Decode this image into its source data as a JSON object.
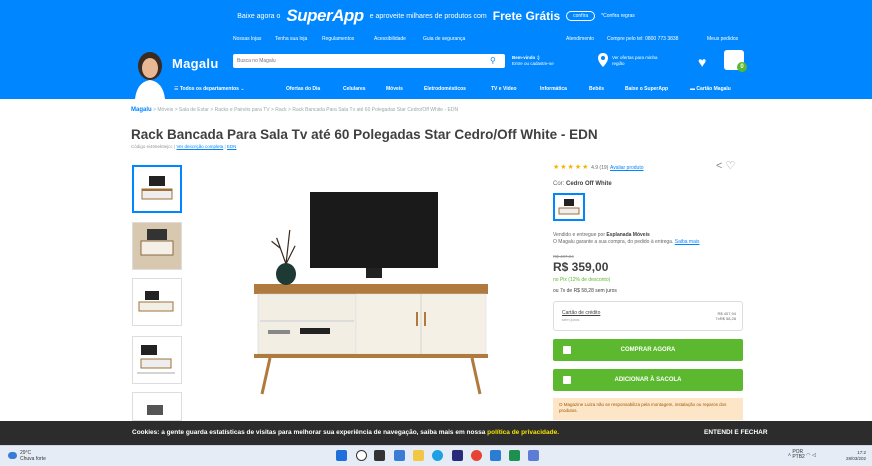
{
  "promo": {
    "text1": "Baixe agora o",
    "brand": "SuperApp",
    "text2": "e aproveite milhares de produtos com",
    "frete": "Frete Grátis",
    "pill": "confira",
    "terms": "*Confira regras"
  },
  "header": {
    "links_left": [
      "Nossas lojas",
      "Tenha sua loja",
      "Regulamentos",
      "Acessibilidade",
      "Guia de segurança"
    ],
    "links_right": [
      "Atendimento",
      "Compre pelo tel: 0800 773 3838",
      "Meus pedidos"
    ],
    "logo": "Magalu",
    "search_placeholder": "Busca no Magalu",
    "welcome_line1": "Bem-vindo :)",
    "welcome_line2": "Entre ou cadastre-se",
    "location_line1": "Ver ofertas para minha",
    "location_line2": "região",
    "cart_count": "0"
  },
  "nav": [
    "Todos os departamentos",
    "Ofertas do Dia",
    "Celulares",
    "Móveis",
    "Eletrodomésticos",
    "TV e Vídeo",
    "Informática",
    "Bebês",
    "Baixe o SuperApp",
    "Cartão Magalu"
  ],
  "breadcrumb": {
    "brand": "Magalu",
    "path": "> Móveis > Sala de Estar > Racks e Painéis para TV > Rack > Rack Bancada Para Sala Tv até 60 Polegadas Star Cedro/Off White - EDN"
  },
  "product": {
    "title": "Rack Bancada Para Sala Tv até 60 Polegadas Star Cedro/Off White - EDN",
    "code": "Código ei465ek9ejcc",
    "code_link": "Ver descrição completa",
    "code_brand": "EDN",
    "rating_stars": "★★★★★",
    "rating_value": "4.9 (19)",
    "rating_link": "Avaliar produto",
    "color_label": "Cor:",
    "color_value": "Cedro Off White",
    "sold_by_prefix": "Vendido e entregue por",
    "seller": "Esplanada Móveis",
    "guarantee": "O Magalu garante a sua compra, do pedido à entrega.",
    "guarantee_link": "Saiba mais",
    "old_price": "R$ 407,94",
    "price": "R$ 359,00",
    "pix_prefix": "no Pix",
    "pix_discount": "(12% de desconto)",
    "installments": "ou 7x de R$ 58,28 sem juros",
    "card_title": "Cartão de crédito",
    "card_sub": "sem juros",
    "card_right1": "R$ 407,94",
    "card_right2": "7xR$ 58,28",
    "buy_button": "COMPRAR AGORA",
    "bag_button": "ADICIONAR À SACOLA",
    "notice": "O Magazine Luiza não se responsabiliza pela montagem, instalação ou reparos dos produtos."
  },
  "cookie": {
    "text": "Cookies: a gente guarda estatísticas de visitas para melhorar sua experiência de navegação, saiba mais em nossa",
    "link": "política de privacidade.",
    "button": "ENTENDI E FECHAR"
  },
  "taskbar": {
    "weather_temp": "29°C",
    "weather_desc": "Chuva forte",
    "lang1": "POR",
    "lang2": "PTB2",
    "time": "17:2",
    "date": "28/03/202"
  }
}
